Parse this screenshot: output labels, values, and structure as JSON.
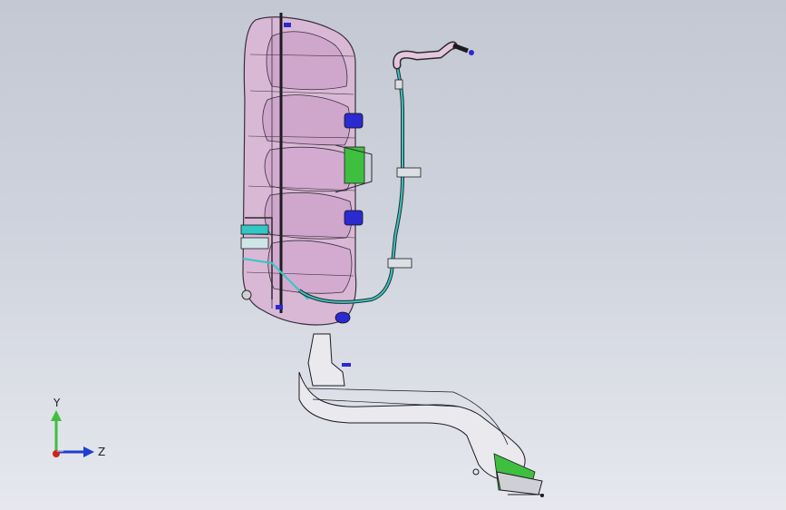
{
  "viewport": {
    "background_top": "#c3c8d3",
    "background_bottom": "#e6e8ee",
    "model_colors": {
      "tank": "#d9b8d6",
      "tank_shade": "#c59ac3",
      "wire": "#3a2f3d",
      "cyan_line": "#33c7c4",
      "blue_fitting": "#2a2ad0",
      "green_part": "#3fbf3f",
      "filler_neck": "#e9e9ee"
    }
  },
  "triad": {
    "y_label": "Y",
    "z_label": "Z",
    "y_color": "#3fbf3f",
    "z_color": "#1f3fcf",
    "x_color": "#d02020"
  }
}
